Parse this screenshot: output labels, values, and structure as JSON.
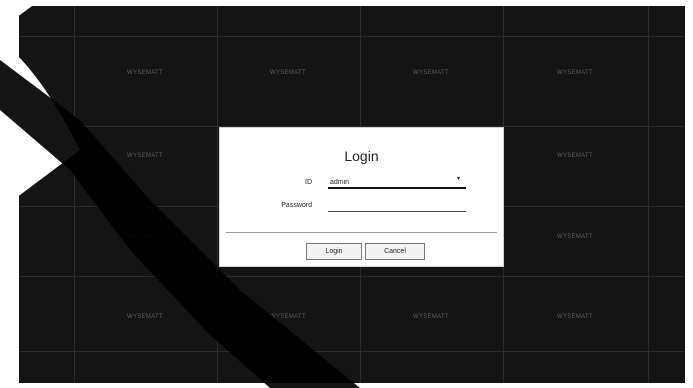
{
  "live_view": {
    "camera_labels": [
      [
        "WYSEMATT",
        "WYSEMATT",
        "WYSEMATT",
        "WYSEMATT"
      ],
      [
        "WYSEMATT",
        "",
        "",
        "WYSEMATT"
      ],
      [
        "WYSEMATT",
        "",
        "",
        "WYSEMATT"
      ],
      [
        "WYSEMATT",
        "WYSEMATT",
        "WYSEMATT",
        "WYSEMATT"
      ]
    ]
  },
  "login_dialog": {
    "title": "Login",
    "id_label": "ID",
    "id_value": "admin",
    "password_label": "Password",
    "password_value": "",
    "login_button": "Login",
    "cancel_button": "Cancel"
  },
  "colors": {
    "background": "#141414",
    "grid_line": "#2c2c2c",
    "dialog": "#ffffff"
  }
}
